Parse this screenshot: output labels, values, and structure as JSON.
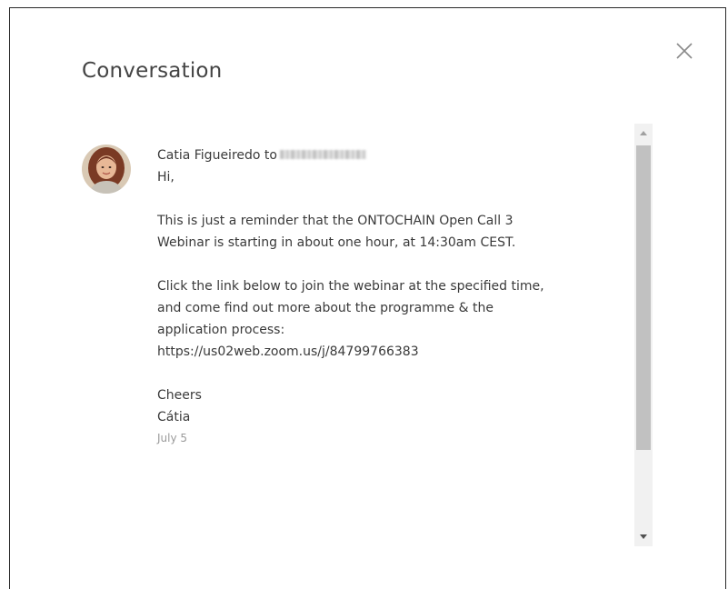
{
  "modal": {
    "title": "Conversation",
    "close_icon": "close-icon"
  },
  "message": {
    "sender": "Catia Figueiredo",
    "to_word": "to",
    "avatar_icon": "avatar",
    "lines": {
      "greeting": "Hi,",
      "p1_l1": "This is just a reminder that the ONTOCHAIN Open Call 3",
      "p1_l2": "Webinar is starting in about one hour, at 14:30am CEST.",
      "p2_l1": "Click the link below to join the webinar at the specified time,",
      "p2_l2": "and come find out more about the programme & the",
      "p2_l3": "application process:",
      "p2_l4": "https://us02web.zoom.us/j/84799766383",
      "closing": "Cheers",
      "signature": "Cátia"
    },
    "date": "July 5"
  },
  "scrollbar": {
    "up_icon": "scroll-up-arrow-icon",
    "down_icon": "scroll-down-arrow-icon",
    "position": 0.05
  }
}
